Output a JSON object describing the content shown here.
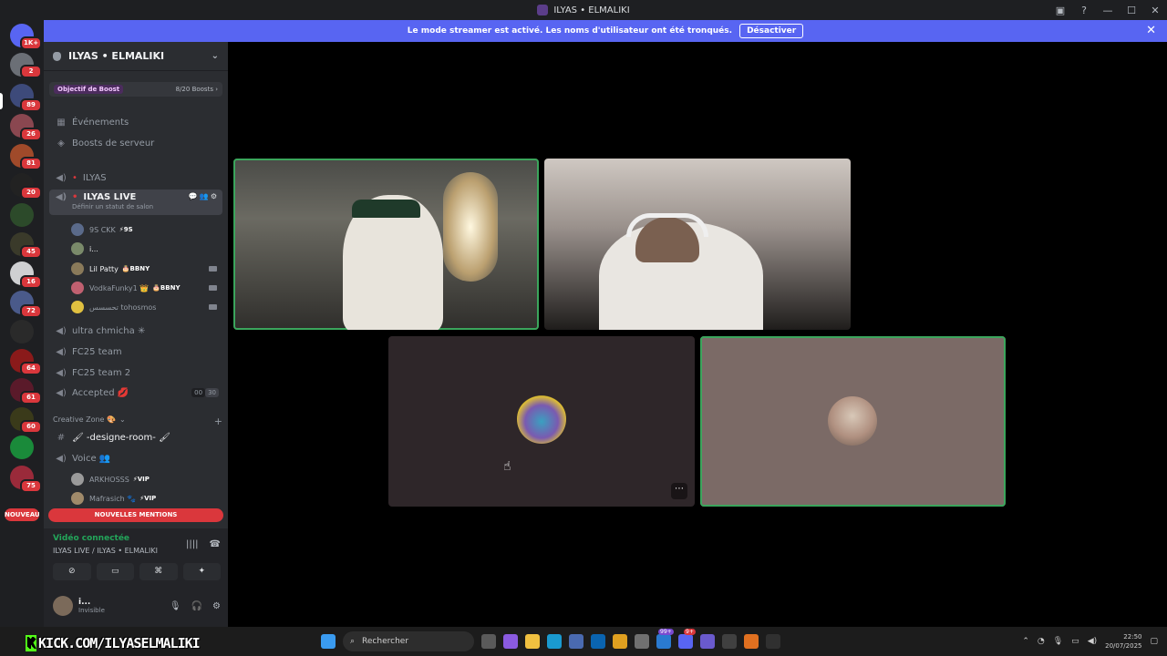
{
  "window": {
    "title": "ILYAS • ELMALIKI"
  },
  "banner": {
    "text": "Le mode streamer est activé. Les noms d'utilisateur ont été tronqués.",
    "button": "Désactiver"
  },
  "servers": {
    "dm_badge": "1K+",
    "badges": [
      "2",
      "89",
      "26",
      "81",
      "20",
      "45",
      "16",
      "72",
      "64",
      "61",
      "60",
      "75"
    ],
    "new_label": "NOUVEAU"
  },
  "guild": {
    "name": "ILYAS • ELMALIKI",
    "boost_label": "Objectif de Boost",
    "boost_count": "8/20 Boosts ›",
    "events": "Événements",
    "server_boosts": "Boosts de serveur",
    "channels": {
      "ilyas": "ILYAS",
      "ilyas_live": "ILYAS LIVE",
      "ilyas_live_status": "Définir un statut de salon",
      "ultra": "ultra chmicha ✳",
      "fc25": "FC25 team",
      "fc25_2": "FC25 team 2",
      "accepted": "Accepted 💋",
      "accepted_count_a": "00",
      "accepted_count_b": "30",
      "category": "Creative Zone 🎨",
      "designe": "🖌 -designe-room- 🖌",
      "voice": "Voice 👥"
    },
    "voice_users": [
      {
        "name": "9S CKK",
        "tag": "⚡9S"
      },
      {
        "name": "i...",
        "tag": ""
      },
      {
        "name": "Lil Patty",
        "tag": "🎂BBNY"
      },
      {
        "name": "VodkaFunky1 👑",
        "tag": "🎂BBNY"
      },
      {
        "name": "تحسسس tohosmos",
        "tag": ""
      }
    ],
    "voice2_users": [
      {
        "name": "ARKHOSSS",
        "tag": "⚡VIP"
      },
      {
        "name": "Mafrasich 🐾",
        "tag": "⚡VIP"
      }
    ],
    "new_mentions": "NOUVELLES MENTIONS"
  },
  "voice_panel": {
    "status": "Vidéo connectée",
    "channel": "ILYAS LIVE / ILYAS • ELMALIKI",
    "user_name": "i...",
    "user_status": "Invisible"
  },
  "taskbar": {
    "overlay": "KICK.COM/ILYASELMALIKI",
    "search": "Rechercher",
    "time": "22:50",
    "date": "20/07/2025",
    "badge_99": "99+",
    "badge_9": "9+"
  },
  "colors": {
    "accent": "#5865f2",
    "speaking": "#3ba55c",
    "danger": "#da373c"
  }
}
